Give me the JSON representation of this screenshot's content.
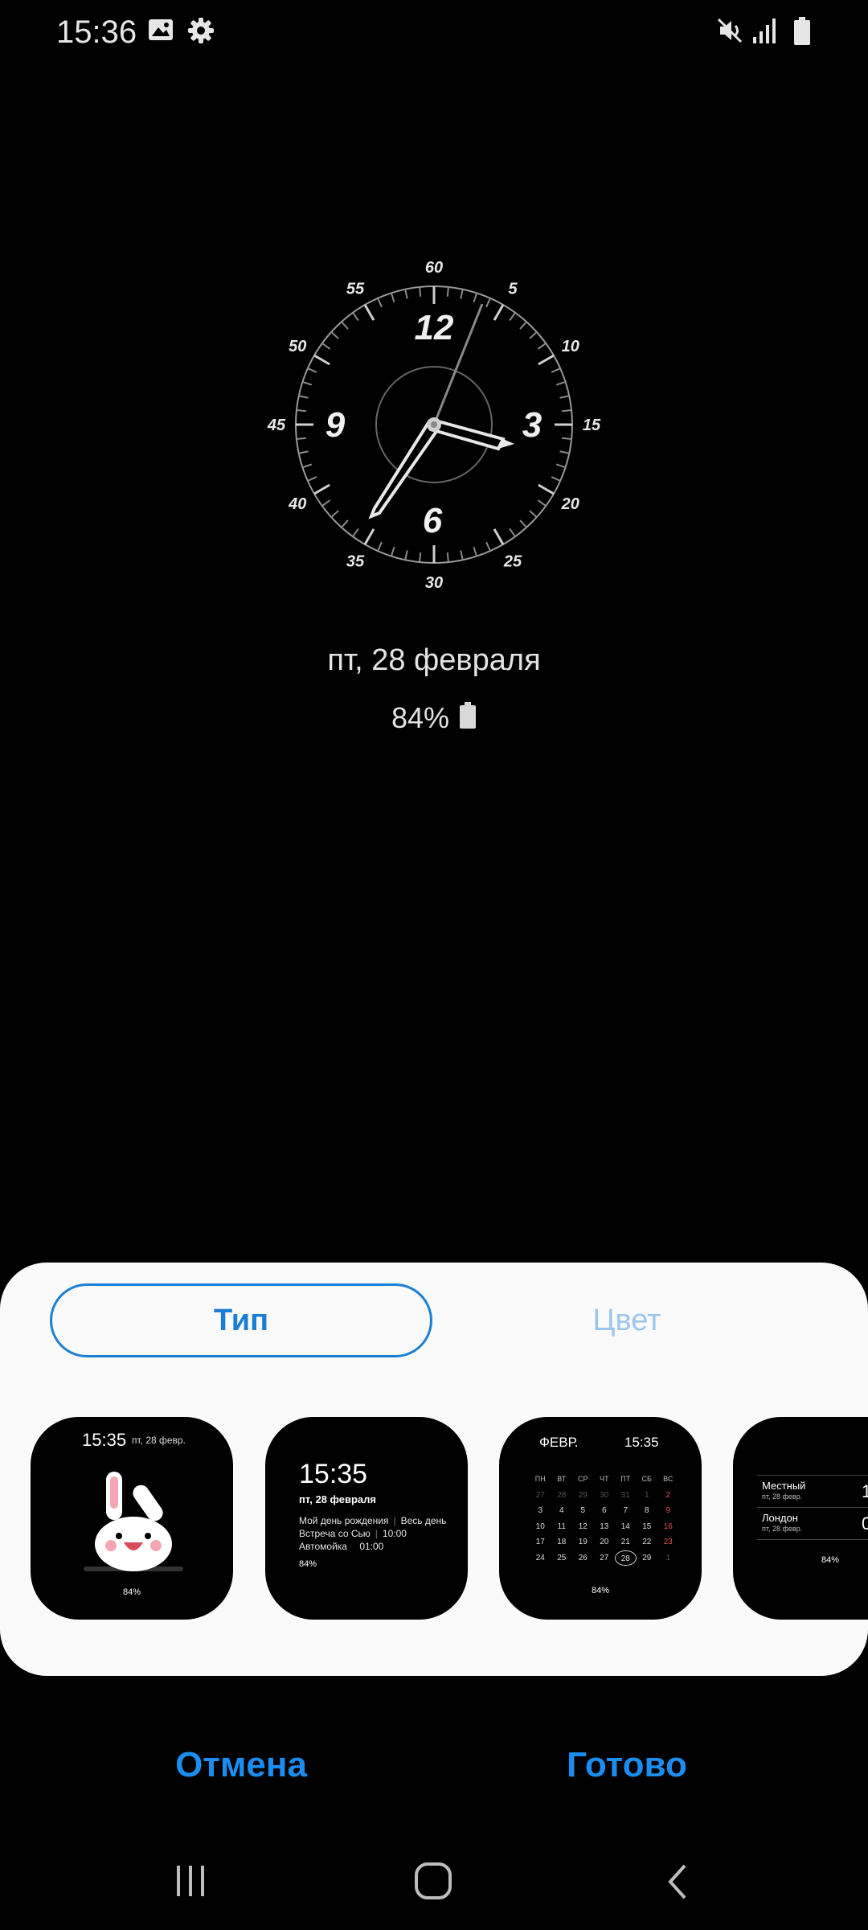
{
  "status_bar": {
    "time": "15:36",
    "icons": [
      "image-icon",
      "gear-icon",
      "mute-icon",
      "signal-icon",
      "battery-icon"
    ]
  },
  "clock": {
    "hour_labels": [
      "12",
      "3",
      "6",
      "9"
    ],
    "minute_labels": [
      "60",
      "5",
      "10",
      "15",
      "20",
      "25",
      "30",
      "35",
      "40",
      "45",
      "50",
      "55"
    ]
  },
  "lock_info": {
    "date": "пт, 28 февраля",
    "battery": "84%"
  },
  "sheet": {
    "tabs": {
      "type": "Тип",
      "color": "Цвет"
    },
    "accent_color": "#1a7fd4",
    "cards": {
      "c1": {
        "time": "15:35",
        "date": "пт, 28 февр.",
        "battery": "84%"
      },
      "c2": {
        "time": "15:35",
        "date": "пт, 28 февраля",
        "events": [
          {
            "title": "Мой день рождения",
            "when": "Весь день"
          },
          {
            "title": "Встреча со Сью",
            "when": "10:00"
          },
          {
            "title": "Автомойка",
            "when": "01:00"
          }
        ],
        "battery": "84%"
      },
      "c3": {
        "month": "ФЕВР.",
        "time": "15:35",
        "battery": "84%",
        "weekdays": [
          "ПН",
          "ВТ",
          "СР",
          "ЧТ",
          "ПТ",
          "СБ",
          "ВС"
        ],
        "weeks": [
          [
            "27",
            "28",
            "29",
            "30",
            "31",
            "1",
            "2"
          ],
          [
            "3",
            "4",
            "5",
            "6",
            "7",
            "8",
            "9"
          ],
          [
            "10",
            "11",
            "12",
            "13",
            "14",
            "15",
            "16"
          ],
          [
            "17",
            "18",
            "19",
            "20",
            "21",
            "22",
            "23"
          ],
          [
            "24",
            "25",
            "26",
            "27",
            "28",
            "29",
            "1"
          ]
        ]
      },
      "c4": {
        "city1": "Местный",
        "city1_date": "пт, 28 февр.",
        "city1_time": "1",
        "city2": "Лондон",
        "city2_date": "пт, 28 февр.",
        "city2_time": "0",
        "battery": "84%"
      }
    }
  },
  "actions": {
    "cancel": "Отмена",
    "done": "Готово"
  },
  "nav": {
    "icons": [
      "recent-apps-icon",
      "home-icon",
      "back-icon"
    ]
  }
}
